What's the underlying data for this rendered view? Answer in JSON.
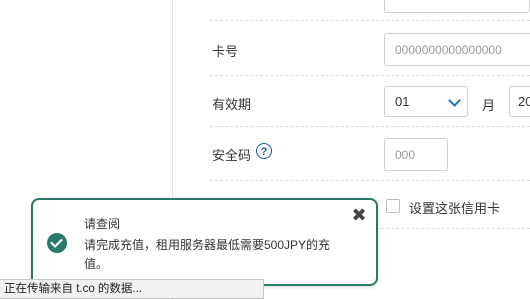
{
  "form": {
    "card_number": {
      "label": "卡号",
      "placeholder": "0000000000000000"
    },
    "expiry": {
      "label": "有效期",
      "month_value": "01",
      "month_unit": "月",
      "year_value": "20"
    },
    "cvv": {
      "label": "安全码",
      "help_glyph": "?",
      "placeholder": "000"
    },
    "default_card": {
      "label": "设置这张信用卡"
    }
  },
  "toast": {
    "title": "请查阅",
    "message": "请完成充值，租用服务器最低需要500JPY的充值。",
    "close_glyph": "✖",
    "accent_color": "#2a7a6a"
  },
  "statusbar": {
    "text": "正在传输来自 t.co 的数据..."
  },
  "colors": {
    "chevron": "#1a73c9",
    "help_icon": "#1a56a8"
  }
}
